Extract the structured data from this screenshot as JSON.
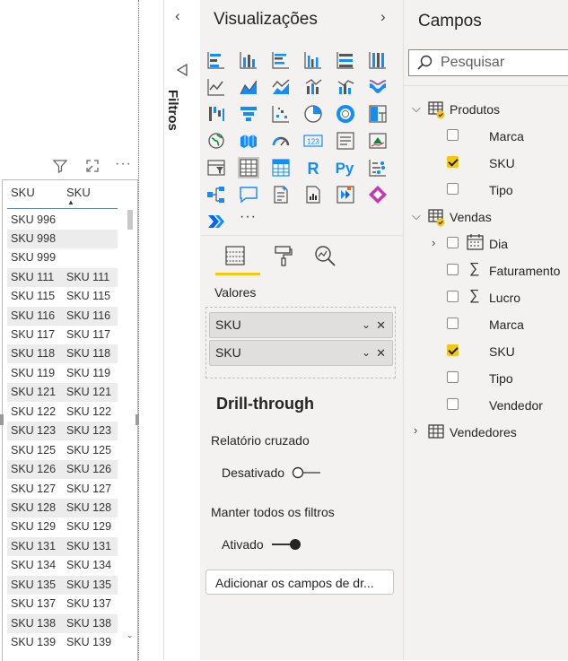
{
  "table": {
    "headers": [
      "SKU",
      "SKU"
    ],
    "rows": [
      [
        "SKU 996",
        ""
      ],
      [
        "SKU 998",
        ""
      ],
      [
        "SKU 999",
        ""
      ],
      [
        "SKU 111",
        "SKU 111"
      ],
      [
        "SKU 115",
        "SKU 115"
      ],
      [
        "SKU 116",
        "SKU 116"
      ],
      [
        "SKU 117",
        "SKU 117"
      ],
      [
        "SKU 118",
        "SKU 118"
      ],
      [
        "SKU 119",
        "SKU 119"
      ],
      [
        "SKU 121",
        "SKU 121"
      ],
      [
        "SKU 122",
        "SKU 122"
      ],
      [
        "SKU 123",
        "SKU 123"
      ],
      [
        "SKU 125",
        "SKU 125"
      ],
      [
        "SKU 126",
        "SKU 126"
      ],
      [
        "SKU 127",
        "SKU 127"
      ],
      [
        "SKU 128",
        "SKU 128"
      ],
      [
        "SKU 129",
        "SKU 129"
      ],
      [
        "SKU 131",
        "SKU 131"
      ],
      [
        "SKU 134",
        "SKU 134"
      ],
      [
        "SKU 135",
        "SKU 135"
      ],
      [
        "SKU 137",
        "SKU 137"
      ],
      [
        "SKU 138",
        "SKU 138"
      ],
      [
        "SKU 139",
        "SKU 139"
      ]
    ],
    "header_icons": [
      "filter-icon",
      "focus-mode-icon",
      "more-options-icon"
    ]
  },
  "filters": {
    "title": "Filtros"
  },
  "visualizations": {
    "title": "Visualizações",
    "wells_label": "Valores",
    "wells": [
      "SKU",
      "SKU"
    ],
    "drill": {
      "title": "Drill-through",
      "cross_report_label": "Relatório cruzado",
      "cross_report_state": "Desativado",
      "keep_filters_label": "Manter todos os filtros",
      "keep_filters_state": "Ativado",
      "add_fields": "Adicionar os campos de dr..."
    }
  },
  "fields": {
    "title": "Campos",
    "search_placeholder": "Pesquisar",
    "tables": [
      {
        "name": "Produtos",
        "expanded": true,
        "fields": [
          {
            "name": "Marca",
            "checked": false
          },
          {
            "name": "SKU",
            "checked": true
          },
          {
            "name": "Tipo",
            "checked": false
          }
        ]
      },
      {
        "name": "Vendas",
        "expanded": true,
        "fields": [
          {
            "name": "Dia",
            "checked": false
          },
          {
            "name": "Faturamento",
            "checked": false
          },
          {
            "name": "Lucro",
            "checked": false
          },
          {
            "name": "Marca",
            "checked": false
          },
          {
            "name": "SKU",
            "checked": true
          },
          {
            "name": "Tipo",
            "checked": false
          },
          {
            "name": "Vendedor",
            "checked": false
          }
        ]
      },
      {
        "name": "Vendedores",
        "expanded": false,
        "fields": []
      }
    ]
  },
  "colors": {
    "accent": "#f2c811",
    "pane_bg": "#f3f2f1",
    "viz_blue": "#118dff"
  }
}
